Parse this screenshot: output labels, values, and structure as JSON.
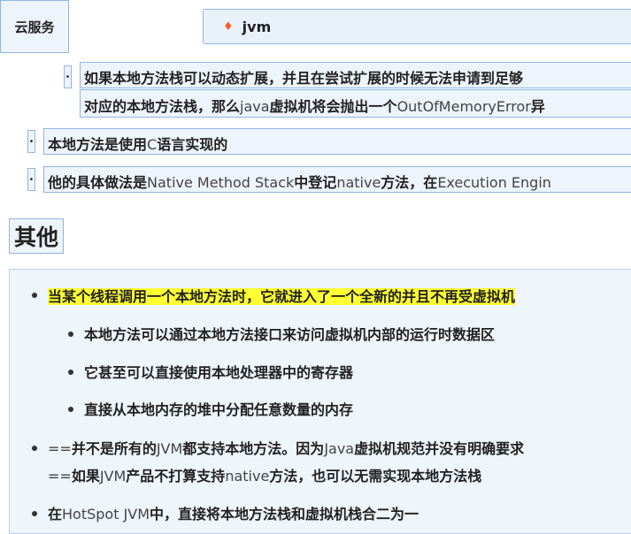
{
  "header": {
    "tag_label": "云服务",
    "tab_icon": "flame-icon",
    "tab_label": "jvm"
  },
  "items": {
    "nested_line1": "如果本地方法栈可以动态扩展，并且在尝试扩展的时候无法申请到足够",
    "nested_line2_a": "对应的本地方法栈，那么",
    "nested_line2_b": "java",
    "nested_line2_c": "虚拟机将会抛出一个",
    "nested_line2_d": "OutOfMemoryError",
    "nested_line2_e": "异",
    "item2_a": "本地方法是使用",
    "item2_b": "C",
    "item2_c": "语言实现的",
    "item3_a": "他的具体做法是",
    "item3_b": "Native Method Stack",
    "item3_c": "中登记",
    "item3_d": "native",
    "item3_e": "方法，在",
    "item3_f": "Execution Engin"
  },
  "section": {
    "title": "其他",
    "p1_highlight": "当某个线程调用一个本地方法时，它就进入了一个全新的并且不再受虚拟机",
    "sub1": "本地方法可以通过本地方法接口来访问虚拟机内部的运行时数据区",
    "sub2": "它甚至可以直接使用本地处理器中的寄存器",
    "sub3": "直接从本地内存的堆中分配任意数量的内存",
    "p2_line1_a": "==",
    "p2_line1_b": "并不是所有的",
    "p2_line1_c": "JVM",
    "p2_line1_d": "都支持本地方法。因为",
    "p2_line1_e": "Java",
    "p2_line1_f": "虚拟机规范并没有明确要求",
    "p2_line2_a": "==",
    "p2_line2_b": "如果",
    "p2_line2_c": "JVM",
    "p2_line2_d": "产品不打算支持",
    "p2_line2_e": "native",
    "p2_line2_f": "方法，也可以无需实现本地方法栈",
    "p3_a": "在",
    "p3_b": "HotSpot JVM",
    "p3_c": "中，直接将本地方法栈和虚拟机栈合二为一"
  }
}
